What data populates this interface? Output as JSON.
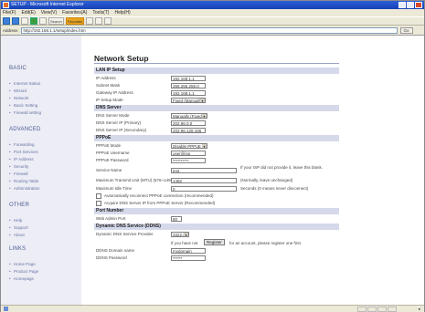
{
  "window": {
    "title": "SETUP - Microsoft Internet Explorer"
  },
  "menu": [
    "File(F)",
    "Edit(E)",
    "View(V)",
    "Favorites(A)",
    "Tools(T)",
    "Help(H)"
  ],
  "toolbar": {
    "search": "Search",
    "favorites": "Favorites"
  },
  "address": {
    "label": "Address",
    "url": "http://192.168.1.1/setup/index.htm",
    "go": "Go"
  },
  "sidebar": {
    "basic": {
      "title": "BASIC",
      "items": [
        "Internet Status",
        "Wizard",
        "Network",
        "Basic Setting",
        "Firewall setting"
      ]
    },
    "advanced": {
      "title": "ADVANCED",
      "items": [
        "Forwarding",
        "Port Services",
        "IP Address",
        "Security",
        "Firewall",
        "Routing Table",
        "Administration"
      ]
    },
    "other": {
      "title": "OTHER",
      "items": [
        "Help",
        "Support",
        "About"
      ]
    },
    "links": {
      "title": "LINKS",
      "items": [
        "Home Page",
        "Product Page",
        "Homepage"
      ]
    }
  },
  "page": {
    "title": "Network Setup"
  },
  "lan": {
    "header": "LAN IP Setup",
    "ip_label": "IP Address",
    "ip_value": "192.168.1.1",
    "mask_label": "Subnet Mask",
    "mask_value": "255.255.255.0",
    "gw_label": "Gateway IP Address",
    "gw_value": "192.168.1.1",
    "mode_label": "IP Setup Mode",
    "mode_value": "Fixed (Manually)"
  },
  "dns": {
    "header": "DNS Server",
    "mode_label": "DNS Server Mode",
    "mode_value": "Manually (Fixed)",
    "primary_label": "DNS Server IP (Primary)",
    "primary_value": "202.96.0.0",
    "secondary_label": "DNS Server IP (Secondary)",
    "secondary_value": "202.96.128.166"
  },
  "pppoe": {
    "header": "PPPoE",
    "mode_label": "PPPoE Mode",
    "mode_value": "Disable PPPoE",
    "user_label": "PPPoE Username",
    "user_value": "user@isp",
    "pass_label": "PPPoE Password",
    "pass_value": "**********",
    "service_label": "Service Name",
    "service_value": "test",
    "service_note": "If your ISP did not provide it, leave this blank.",
    "mtu_label": "Maximum Transmit Unit (MTU) (576~1492)",
    "mtu_value": "1492",
    "mtu_note": "(Normally, leave unchanged)",
    "idle_label": "Maximum Idle Time",
    "idle_value": "0",
    "idle_note": "Seconds (0 means never disconnect)",
    "cb1": "Automatically reconnect PPPoE connection (recommended)",
    "cb2": "Acquire DNS Server IP from PPPoE Server (Recommended)"
  },
  "port": {
    "header": "Port Number",
    "web_label": "Web Admin Port",
    "web_value": "80"
  },
  "ddns": {
    "header": "Dynamic DNS Service (DDNS)",
    "provider_label": "Dynamic DNS Service Provider",
    "provider_value": "3322.org",
    "register_prefix": "If you have not",
    "register_btn": "Register",
    "register_suffix": "for an account, please register one first.",
    "domain_label": "DDNS Domain name",
    "domain_value": "mydomain",
    "pass_label": "DDNS Password",
    "pass_value": "******"
  }
}
